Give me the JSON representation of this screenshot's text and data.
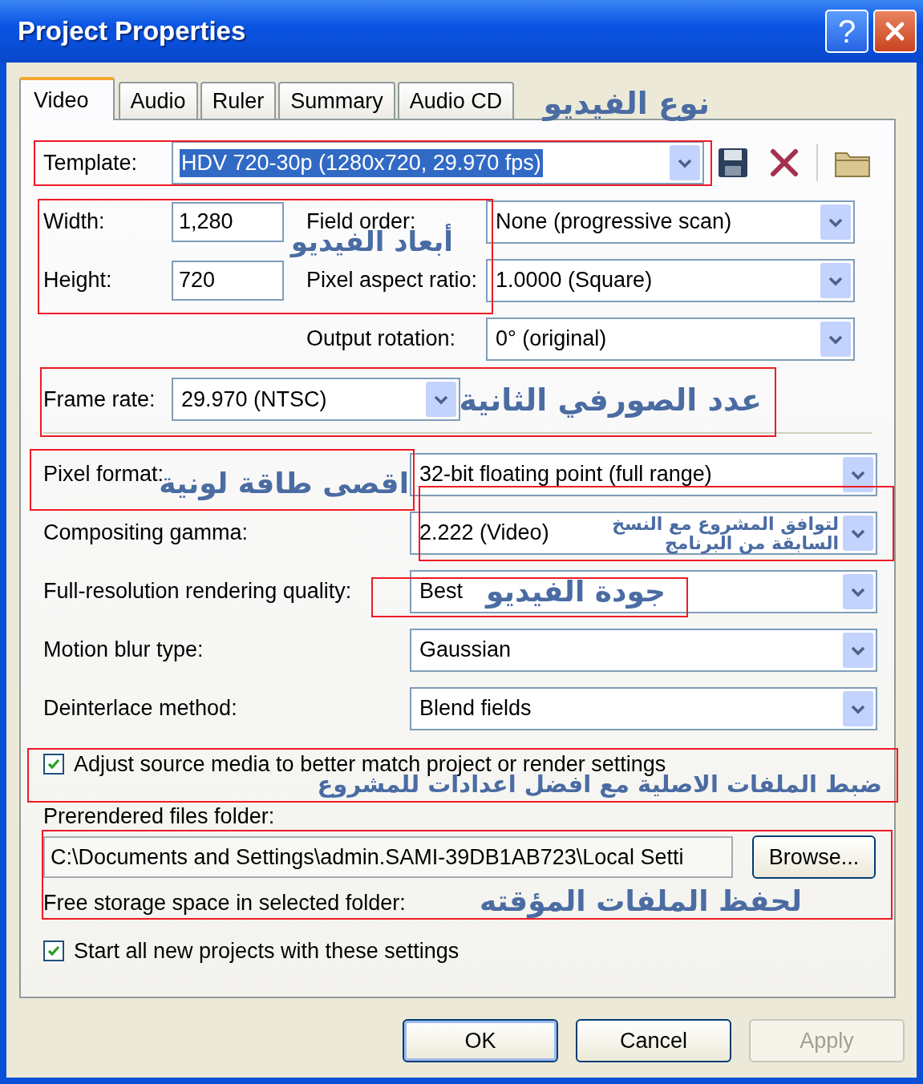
{
  "window": {
    "title": "Project Properties",
    "help": "?"
  },
  "tabs": [
    {
      "label": "Video",
      "selected": true
    },
    {
      "label": "Audio",
      "selected": false
    },
    {
      "label": "Ruler",
      "selected": false
    },
    {
      "label": "Summary",
      "selected": false
    },
    {
      "label": "Audio CD",
      "selected": false
    }
  ],
  "template": {
    "label": "Template:",
    "value": "HDV 720-30p (1280x720, 29.970 fps)",
    "text_selected": true
  },
  "size_fields": [
    {
      "label": "Width:",
      "value": "1,280"
    },
    {
      "label": "Height:",
      "value": "720"
    }
  ],
  "right_dropdowns": [
    {
      "label": "Field order:",
      "value": "None (progressive scan)"
    },
    {
      "label": "Pixel aspect ratio:",
      "value": "1.0000 (Square)"
    },
    {
      "label": "Output rotation:",
      "value": "0° (original)"
    }
  ],
  "frame_rate": {
    "label": "Frame rate:",
    "value": "29.970 (NTSC)"
  },
  "settings": [
    {
      "label": "Pixel format:",
      "value": "32-bit floating point (full range)"
    },
    {
      "label": "Compositing gamma:",
      "value": "2.222 (Video)"
    },
    {
      "label": "Full-resolution rendering quality:",
      "value": "Best"
    },
    {
      "label": "Motion blur type:",
      "value": "Gaussian"
    },
    {
      "label": "Deinterlace method:",
      "value": "Blend fields"
    }
  ],
  "adjust_checkbox": {
    "label": "Adjust source media to better match project or render settings",
    "checked": true
  },
  "prerendered": {
    "label": "Prerendered files folder:",
    "path": "C:\\Documents and Settings\\admin.SAMI-39DB1AB723\\Local Setti",
    "browse": "Browse...",
    "free_space": "Free storage space in selected folder:"
  },
  "start_checkbox": {
    "label": "Start all new projects with these settings",
    "checked": true
  },
  "buttons": [
    {
      "label": "OK",
      "disabled": false,
      "default": true
    },
    {
      "label": "Cancel",
      "disabled": false,
      "default": false
    },
    {
      "label": "Apply",
      "disabled": true,
      "default": false
    }
  ],
  "annotations": [
    {
      "text": "نوع الفيديو"
    },
    {
      "text": "أبعاد الفيديو"
    },
    {
      "text": "عدد الصورفي الثانية"
    },
    {
      "text": "اقصى طاقة لونية"
    },
    {
      "text": "لتوافق المشروع مع النسخ السابقة من البرنامج"
    },
    {
      "text": "جودة الفيديو"
    },
    {
      "text": "ضبط الملفات الاصلية مع افضل اعدادات للمشروع"
    },
    {
      "text": "لحفظ الملفات المؤقته"
    }
  ]
}
